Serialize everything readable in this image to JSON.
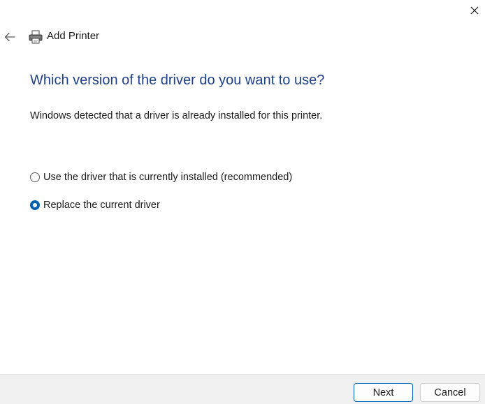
{
  "header": {
    "title": "Add Printer",
    "back_icon": "back-arrow-icon",
    "printer_icon": "printer-icon",
    "close_icon": "close-icon"
  },
  "main": {
    "heading": "Which version of the driver do you want to use?",
    "description": "Windows detected that a driver is already installed for this printer.",
    "options": [
      {
        "label": "Use the driver that is currently installed (recommended)",
        "selected": false
      },
      {
        "label": "Replace the current driver",
        "selected": true
      }
    ]
  },
  "footer": {
    "next_label": "Next",
    "cancel_label": "Cancel"
  },
  "colors": {
    "heading": "#1e3f8a",
    "accent": "#0063b1",
    "footer_bg": "#f0f0f0"
  }
}
